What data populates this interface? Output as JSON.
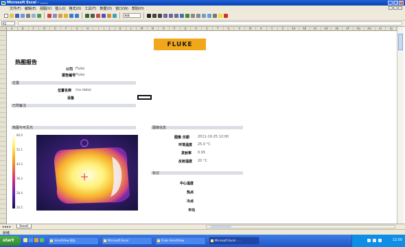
{
  "window": {
    "app_title": "Microsoft Excel - ......",
    "menus": [
      "文件(F)",
      "编辑(E)",
      "视图(V)",
      "插入(I)",
      "格式(O)",
      "工具(T)",
      "数据(D)",
      "窗口(W)",
      "帮助(H)"
    ]
  },
  "toolbar": {
    "font_value": "宋体"
  },
  "formula_bar": {
    "name_box": "A1"
  },
  "columns": [
    "A",
    "B",
    "C",
    "D",
    "E",
    "F",
    "G",
    "H",
    "I",
    "J",
    "K",
    "L",
    "M",
    "N",
    "O",
    "P",
    "Q",
    "R",
    "S",
    "T",
    "U",
    "V",
    "W",
    "X",
    "Y",
    "Z",
    "AA",
    "AB",
    "AC",
    "AD",
    "AE",
    "AF",
    "AG",
    "AH",
    "AI",
    "AJ"
  ],
  "report": {
    "logo_text": "FLUKE",
    "title": "热图报告",
    "company_label": "公司",
    "company_value": "Fluke",
    "report_by_label": "报告编号",
    "report_by_value": "Fluke",
    "section_location": "位置",
    "location_label": "位置名称",
    "location_value": "(no data)",
    "device_label": "设备",
    "section_notes": "已附备注",
    "section_image": "热图与可见光",
    "section_info": "图像信息",
    "info": [
      {
        "label": "图像 日期",
        "value": "2011-10-25 12:00"
      },
      {
        "label": "环境温度",
        "value": "25.0 °C"
      },
      {
        "label": "发射率",
        "value": "0.95"
      },
      {
        "label": "反射温度",
        "value": "20 °C"
      }
    ],
    "section_markers": "标记",
    "markers": [
      {
        "label": "中心温度"
      },
      {
        "label": "热点"
      },
      {
        "label": "冷点"
      },
      {
        "label": "平均"
      }
    ],
    "scale_ticks": [
      "60.0",
      "52.1",
      "44.2",
      "36.3",
      "28.4",
      "20.5"
    ]
  },
  "sheet_tab": "Sheet1",
  "status": "就绪",
  "taskbar": {
    "start": "start",
    "tasks": [
      "SmartView 报告",
      "Microsoft Excel",
      "Fluke SmartView",
      "Microsoft Excel - ..."
    ],
    "clock": "12:00"
  },
  "colors": {
    "logo": "#f2a61a",
    "title_bar": "#1f63d6",
    "band": "#dcdee6",
    "taskbar": "#2356c6"
  }
}
